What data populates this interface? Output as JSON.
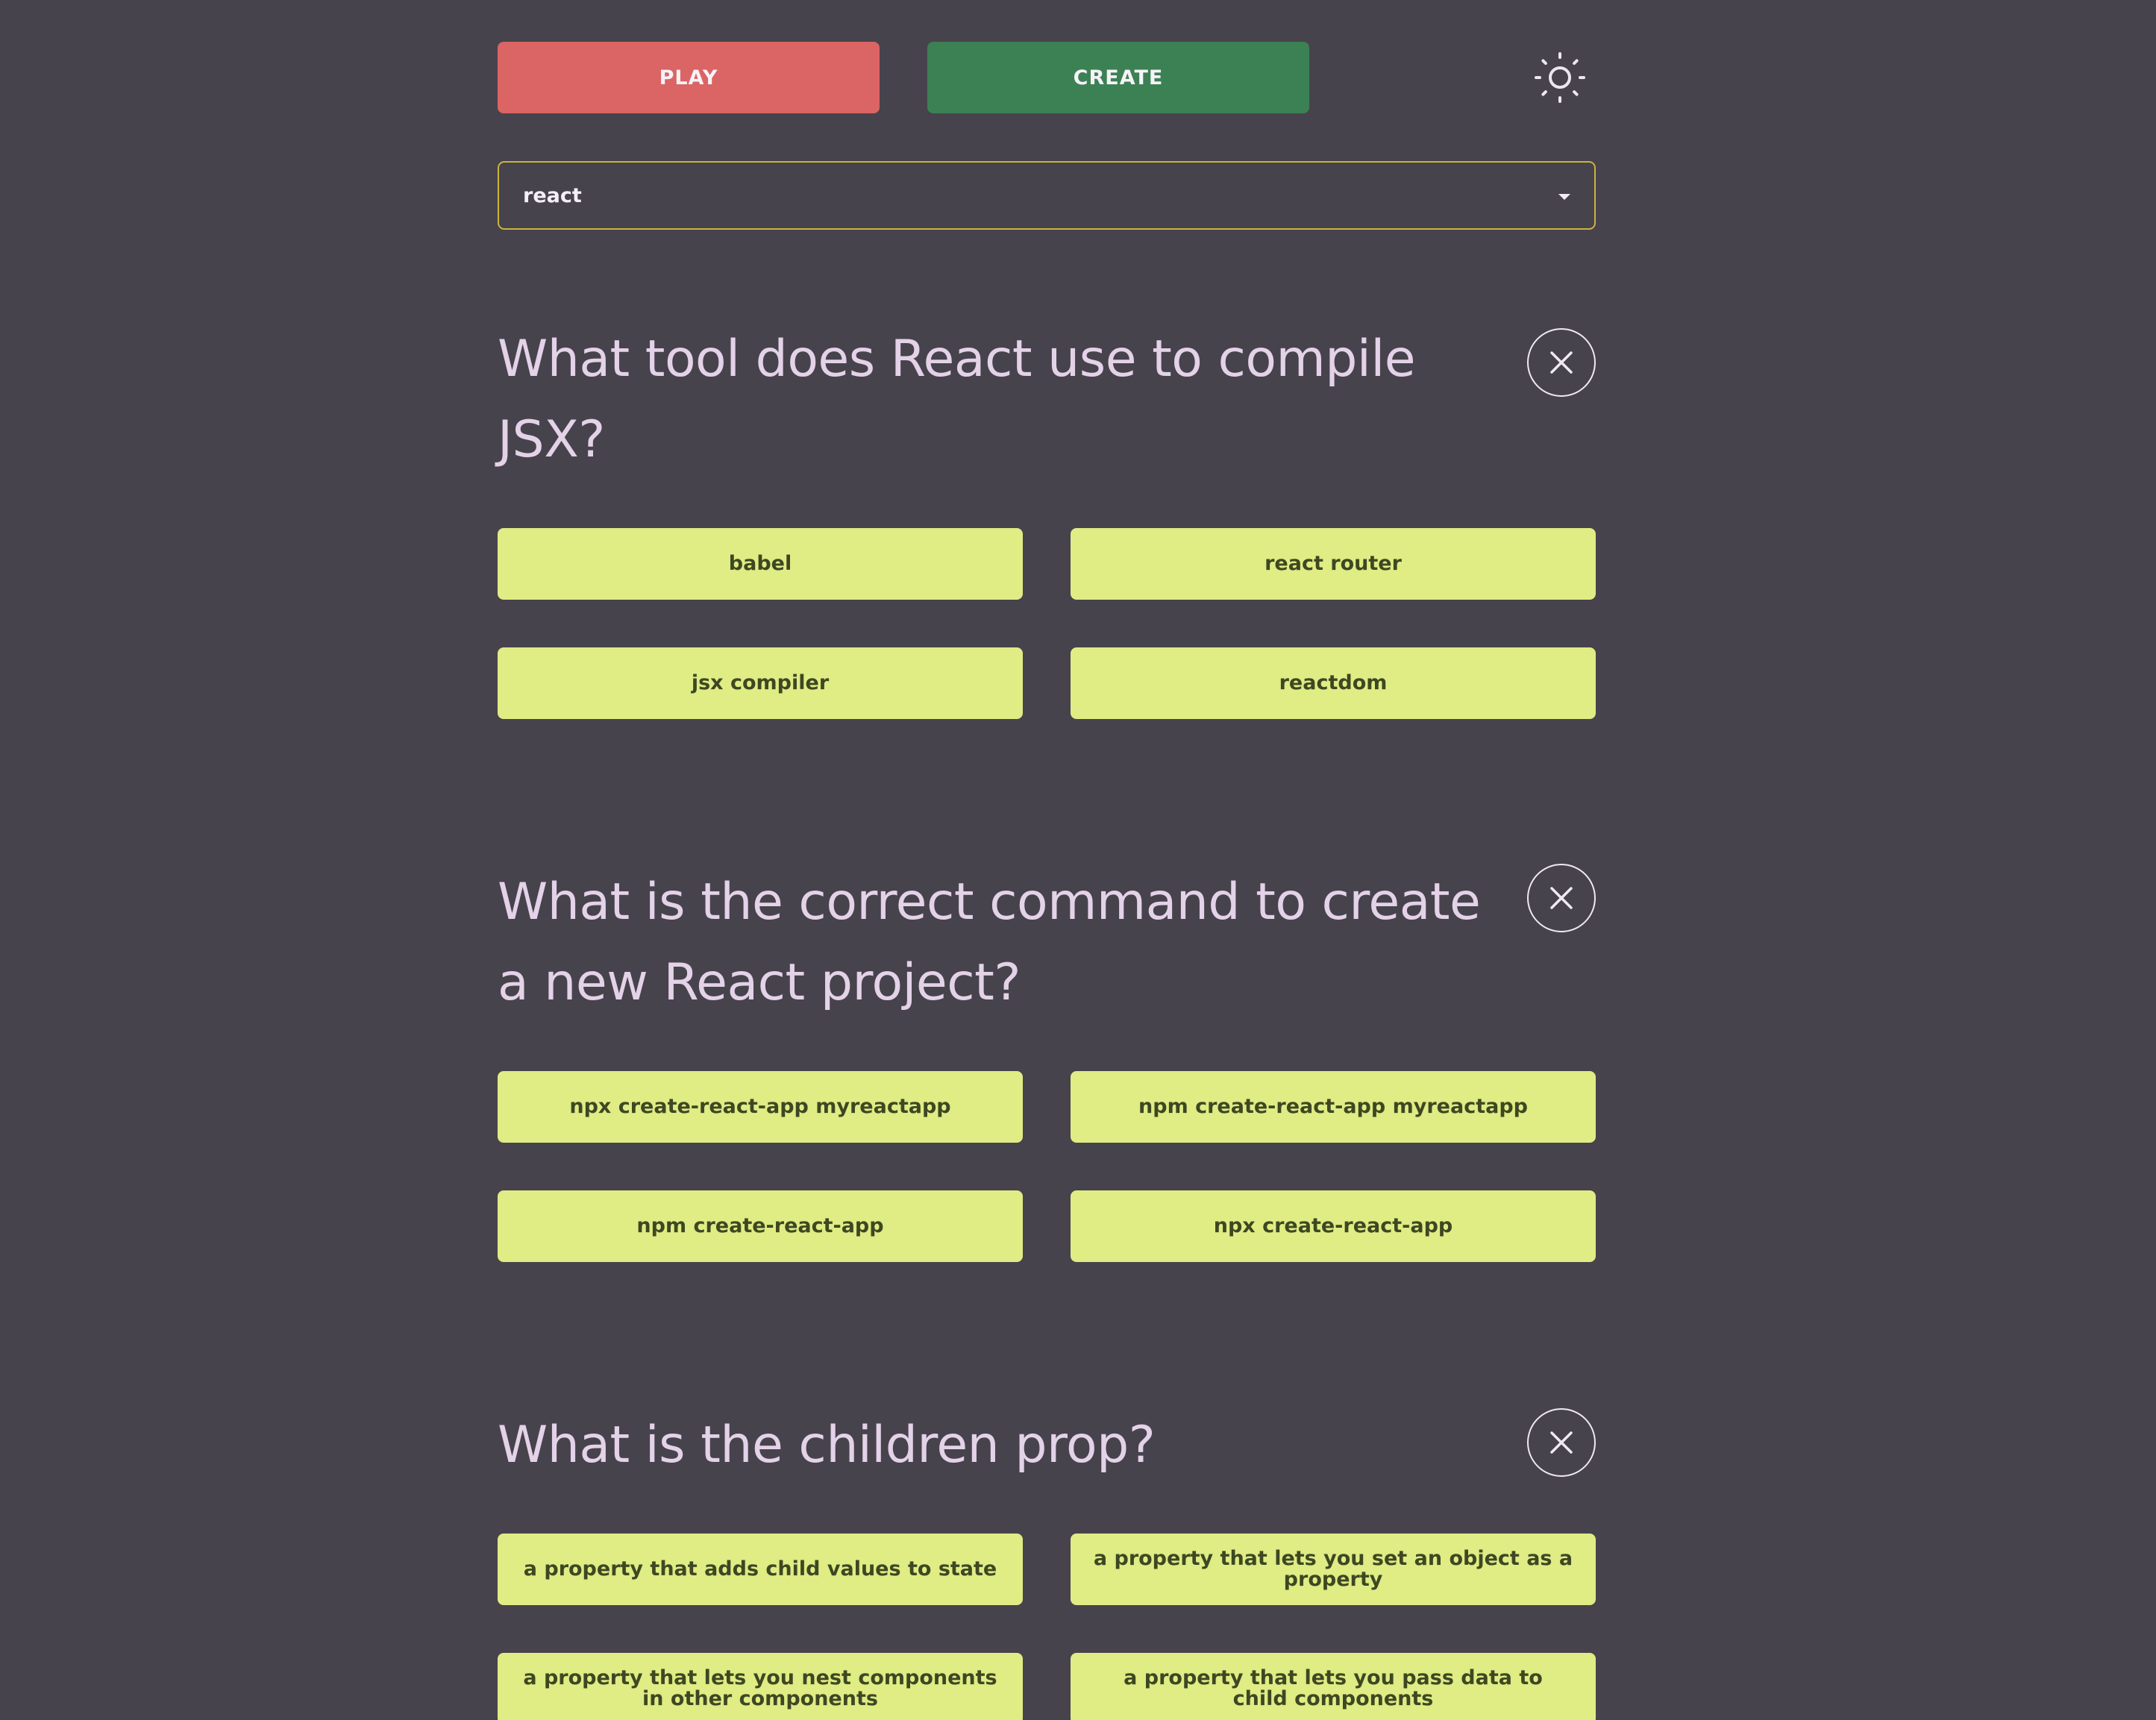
{
  "toolbar": {
    "play_label": "PLAY",
    "create_label": "CREATE",
    "theme_icon": "sun-icon"
  },
  "topic_select": {
    "value": "react"
  },
  "questions": [
    {
      "text": "What tool does React use to compile JSX?",
      "answers": [
        "babel",
        "react router",
        "jsx compiler",
        "reactdom"
      ]
    },
    {
      "text": "What is the correct command to create a new React project?",
      "answers": [
        "npx create-react-app myreactapp",
        "npm create-react-app myreactapp",
        "npm create-react-app",
        "npx create-react-app"
      ]
    },
    {
      "text": "What is the children prop?",
      "answers": [
        "a property that adds child values to state",
        "a property that lets you set an object as a property",
        "a property that lets you nest components in other components",
        "a property that lets you pass data to child components"
      ]
    }
  ],
  "colors": {
    "background": "#47434c",
    "play": "#db6464",
    "create": "#3c8154",
    "answer": "#e0ec84",
    "question_text": "#e3d2e8",
    "select_border": "#c9b43e"
  }
}
